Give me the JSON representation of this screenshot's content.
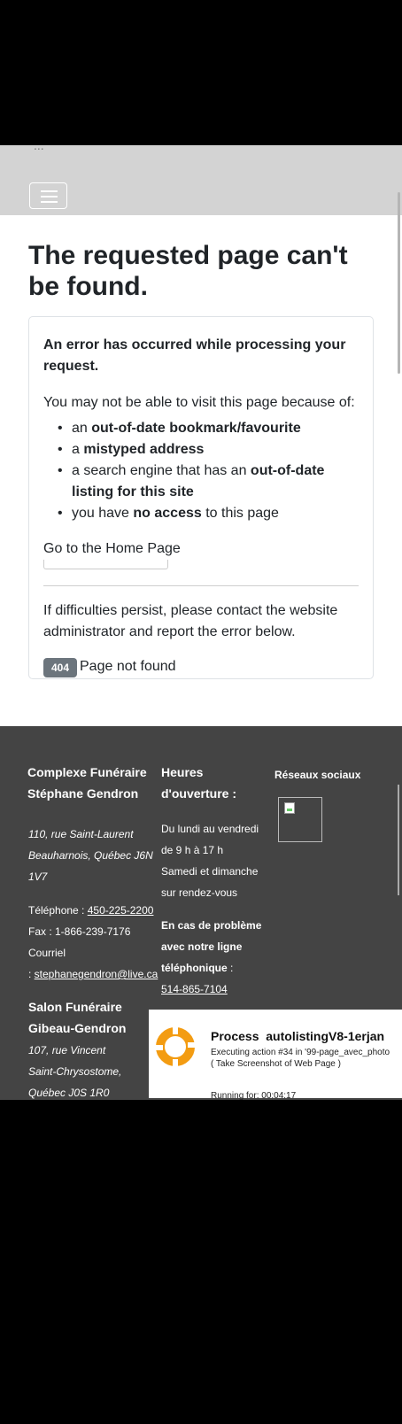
{
  "header": {
    "top_cut_text": "...",
    "menu_label": "Toggle navigation"
  },
  "error": {
    "title": "The requested page can't be found.",
    "lead": "An error has occurred while processing your request.",
    "intro": "You may not be able to visit this page because of:",
    "reasons": [
      {
        "before": "an ",
        "bold": "out-of-date bookmark/favourite",
        "after": ""
      },
      {
        "before": "a ",
        "bold": "mistyped address",
        "after": ""
      },
      {
        "before": "a search engine that has an ",
        "bold": "out-of-date listing for this site",
        "after": ""
      },
      {
        "before": "you have ",
        "bold": "no access",
        "after": " to this page"
      }
    ],
    "home_link": "Go to the Home Page",
    "persist": "If difficulties persist, please contact the website administrator and report the error below.",
    "badge": "404",
    "badge_text": "Page not found"
  },
  "footer": {
    "col1": {
      "name_line1": "Complexe Funéraire",
      "name_line2": "Stéphane Gendron",
      "addr1": "110, rue Saint-Laurent",
      "addr2": "Beauharnois, Québec J6N",
      "addr3": "1V7",
      "phone_label": "Téléphone : ",
      "phone": "450-225-2200",
      "fax": "Fax : 1-866-239-7176",
      "email_label": "Courriel",
      "email_prefix": ": ",
      "email": "stephanegendron@live.ca",
      "salon_line1": "Salon Funéraire",
      "salon_line2": "Gibeau-Gendron",
      "salon_addr1": "107, rue Vincent",
      "salon_addr2": "Saint-Chrysostome,",
      "salon_addr3": "Québec J0S 1R0"
    },
    "col2": {
      "title_line1": "Heures",
      "title_line2": "d'ouverture :",
      "hours1": "Du lundi au vendredi",
      "hours2": "de 9 h à 17 h",
      "hours3": "Samedi et dimanche",
      "hours4": "sur rendez-vous",
      "problem1": "En cas de problème",
      "problem2": "avec notre ligne",
      "problem3": "téléphonique",
      "problem_suffix": " :",
      "problem_phone": "514-865-7104"
    },
    "col3": {
      "title": "Réseaux sociaux",
      "icon": "broken-image-icon"
    }
  },
  "process": {
    "title_prefix": "Process",
    "title_name": "autolistingV8-1erjan",
    "action_line1": "Executing action #34 in '99-page_avec_photo",
    "action_line2": "( Take Screenshot of Web Page )",
    "running": "Running for: 00:04:17"
  }
}
